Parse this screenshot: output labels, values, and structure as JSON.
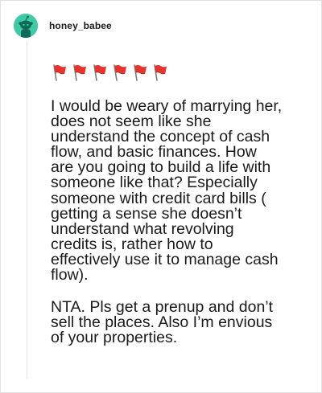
{
  "comment": {
    "author": "honey_babee",
    "avatar_icon": "snoo-avatar-icon",
    "avatar_color": "#40c9a5",
    "emoji_icon": "red-flag-icon",
    "emoji_count": 6,
    "paragraphs": [
      "I would be weary of marrying her,\ndoes not seem like she\nunderstand the concept of cash\nflow, and basic finances. How\nare you going to build a life with\nsomeone like that? Especially\nsomeone with credit card bills (\ngetting a sense she doesn’t\nunderstand what revolving\ncredits is, rather how to\neffectively use it to manage cash\nflow).",
      "NTA. Pls get a prenup and don’t\nsell the places. Also I’m envious\nof your properties."
    ]
  }
}
